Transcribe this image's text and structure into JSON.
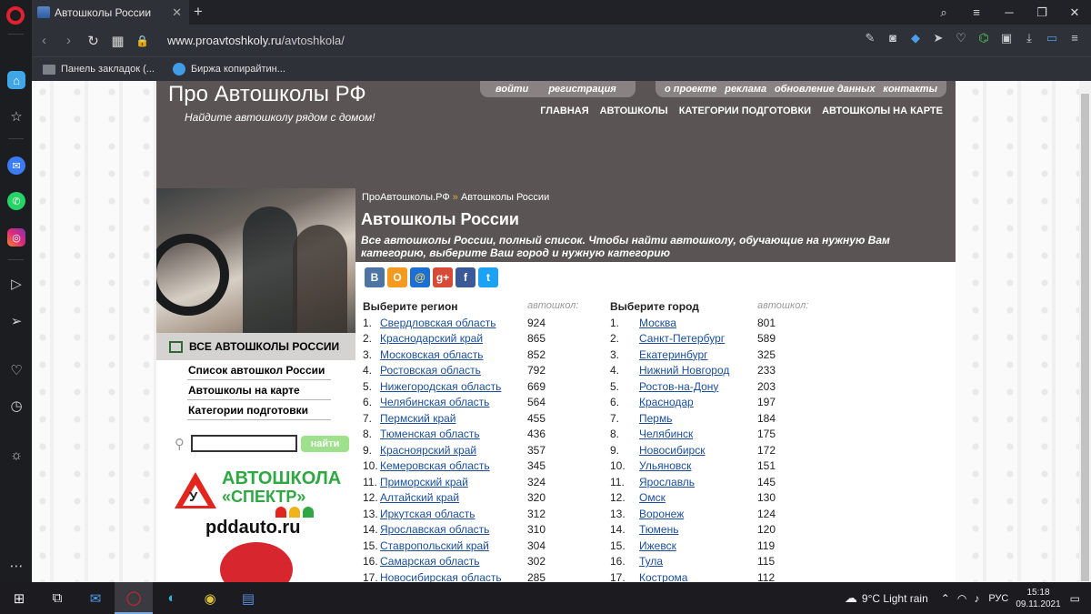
{
  "browser": {
    "tab_title": "Автошколы России",
    "url_domain": "www.proavtoshkoly.ru",
    "url_path": "/avtoshkola/",
    "bookmarks": [
      "Панель закладок (...",
      "Биржа копирайтин..."
    ]
  },
  "site": {
    "title": "Про Автошколы РФ",
    "tagline": "Найдите автошколу рядом с домом!",
    "account_links": [
      "войти",
      "регистрация"
    ],
    "info_links": [
      "о проекте",
      "реклама",
      "обновление данных",
      "контакты"
    ],
    "main_nav": [
      "ГЛАВНАЯ",
      "АВТОШКОЛЫ",
      "КАТЕГОРИИ ПОДГОТОВКИ",
      "АВТОШКОЛЫ НА КАРТЕ"
    ]
  },
  "sidebar": {
    "section_title": "ВСЕ АВТОШКОЛЫ РОССИИ",
    "items": [
      "Список автошкол России",
      "Автошколы на карте",
      "Категории подготовки"
    ],
    "search_button": "найти",
    "ad": {
      "name_line1": "АВТОШКОЛА",
      "name_line2": "«СПЕКТР»",
      "sign_letter": "У",
      "site": "pddauto.ru"
    }
  },
  "main": {
    "breadcrumb": [
      "ПроАвтошколы.РФ",
      "Автошколы России"
    ],
    "breadcrumb_sep": "»",
    "title": "Автошколы России",
    "description": "Все автошколы России, полный список. Чтобы найти автошколу, обучающие на нужную Вам категорию, выберите Ваш город и нужную категорию",
    "social": [
      "В",
      "О",
      "@",
      "g+",
      "f",
      "t"
    ],
    "regions_header": "Выберите регион",
    "cities_header": "Выберите город",
    "count_header": "автошкол:",
    "regions": [
      {
        "n": "1.",
        "name": "Свердловская область",
        "count": "924"
      },
      {
        "n": "2.",
        "name": "Краснодарский край",
        "count": "865"
      },
      {
        "n": "3.",
        "name": "Московская область",
        "count": "852"
      },
      {
        "n": "4.",
        "name": "Ростовская область",
        "count": "792"
      },
      {
        "n": "5.",
        "name": "Нижегородская область",
        "count": "669"
      },
      {
        "n": "6.",
        "name": "Челябинская область",
        "count": "564"
      },
      {
        "n": "7.",
        "name": "Пермский край",
        "count": "455"
      },
      {
        "n": "8.",
        "name": "Тюменская область",
        "count": "436"
      },
      {
        "n": "9.",
        "name": "Красноярский край",
        "count": "357"
      },
      {
        "n": "10.",
        "name": "Кемеровская область",
        "count": "345"
      },
      {
        "n": "11.",
        "name": "Приморский край",
        "count": "324"
      },
      {
        "n": "12.",
        "name": "Алтайский край",
        "count": "320"
      },
      {
        "n": "13.",
        "name": "Иркутская область",
        "count": "312"
      },
      {
        "n": "14.",
        "name": "Ярославская область",
        "count": "310"
      },
      {
        "n": "15.",
        "name": "Ставропольский край",
        "count": "304"
      },
      {
        "n": "16.",
        "name": "Самарская область",
        "count": "302"
      },
      {
        "n": "17.",
        "name": "Новосибирская область",
        "count": "285"
      }
    ],
    "cities": [
      {
        "n": "1.",
        "name": "Москва",
        "count": "801"
      },
      {
        "n": "2.",
        "name": "Санкт-Петербург",
        "count": "589"
      },
      {
        "n": "3.",
        "name": "Екатеринбург",
        "count": "325"
      },
      {
        "n": "4.",
        "name": "Нижний Новгород",
        "count": "233"
      },
      {
        "n": "5.",
        "name": "Ростов-на-Дону",
        "count": "203"
      },
      {
        "n": "6.",
        "name": "Краснодар",
        "count": "197"
      },
      {
        "n": "7.",
        "name": "Пермь",
        "count": "184"
      },
      {
        "n": "8.",
        "name": "Челябинск",
        "count": "175"
      },
      {
        "n": "9.",
        "name": "Новосибирск",
        "count": "172"
      },
      {
        "n": "10.",
        "name": "Ульяновск",
        "count": "151"
      },
      {
        "n": "11.",
        "name": "Ярославль",
        "count": "145"
      },
      {
        "n": "12.",
        "name": "Омск",
        "count": "130"
      },
      {
        "n": "13.",
        "name": "Воронеж",
        "count": "124"
      },
      {
        "n": "14.",
        "name": "Тюмень",
        "count": "120"
      },
      {
        "n": "15.",
        "name": "Ижевск",
        "count": "119"
      },
      {
        "n": "16.",
        "name": "Тула",
        "count": "115"
      },
      {
        "n": "17.",
        "name": "Кострома",
        "count": "112"
      }
    ]
  },
  "taskbar": {
    "weather": "9°C  Light rain",
    "lang": "РУС",
    "time": "15:18",
    "date": "09.11.2021"
  },
  "colors": {
    "header_bg": "#5a5455",
    "link": "#1a4e9c",
    "search_btn": "#9ee08c",
    "opera_red": "#e2212f"
  }
}
